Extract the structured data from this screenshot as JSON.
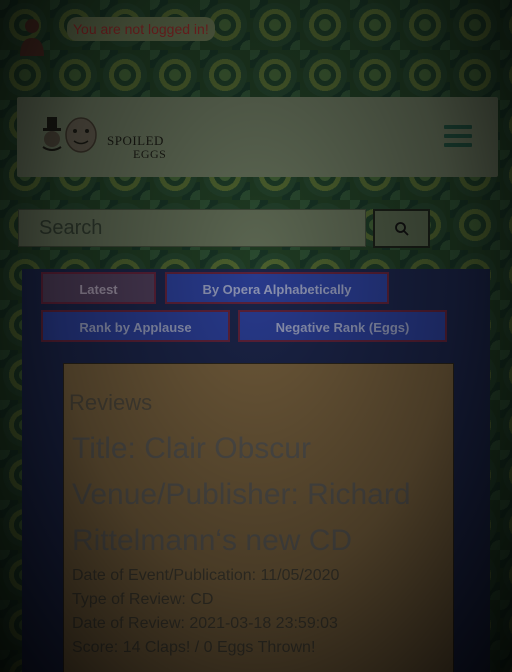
{
  "login": {
    "status_text": "You are not logged in!"
  },
  "header": {
    "logo_line1": "SPOILED",
    "logo_line2": "EGGS"
  },
  "search": {
    "placeholder": "Search"
  },
  "tabs": [
    {
      "label": "Latest",
      "active": true
    },
    {
      "label": "By Opera Alphabetically",
      "active": false
    },
    {
      "label": "Rank by Applause",
      "active": false
    },
    {
      "label": "Negative Rank (Eggs)",
      "active": false
    }
  ],
  "reviews": {
    "heading": "Reviews",
    "items": [
      {
        "title": "Title: Clair Obscur Venue/Publisher: Richard Rittelmann‘s new CD",
        "date_of_event": "Date of Event/Publication: 11/05/2020",
        "type": "Type of Review: CD",
        "date_of_review": "Date of Review: 2021-03-18 23:59:03",
        "score": "Score: 14 Claps! / 0 Eggs Thrown!"
      }
    ]
  },
  "colors": {
    "panel": "#1a2346",
    "tab": "#283a8c",
    "tab_border": "#5b2138",
    "content": "#6f5a3a",
    "status_text": "#8a2727"
  },
  "icons": {
    "login": "user-icon",
    "search": "search-icon",
    "menu": "hamburger-menu-icon",
    "logo": "spoiled-eggs-logo"
  }
}
